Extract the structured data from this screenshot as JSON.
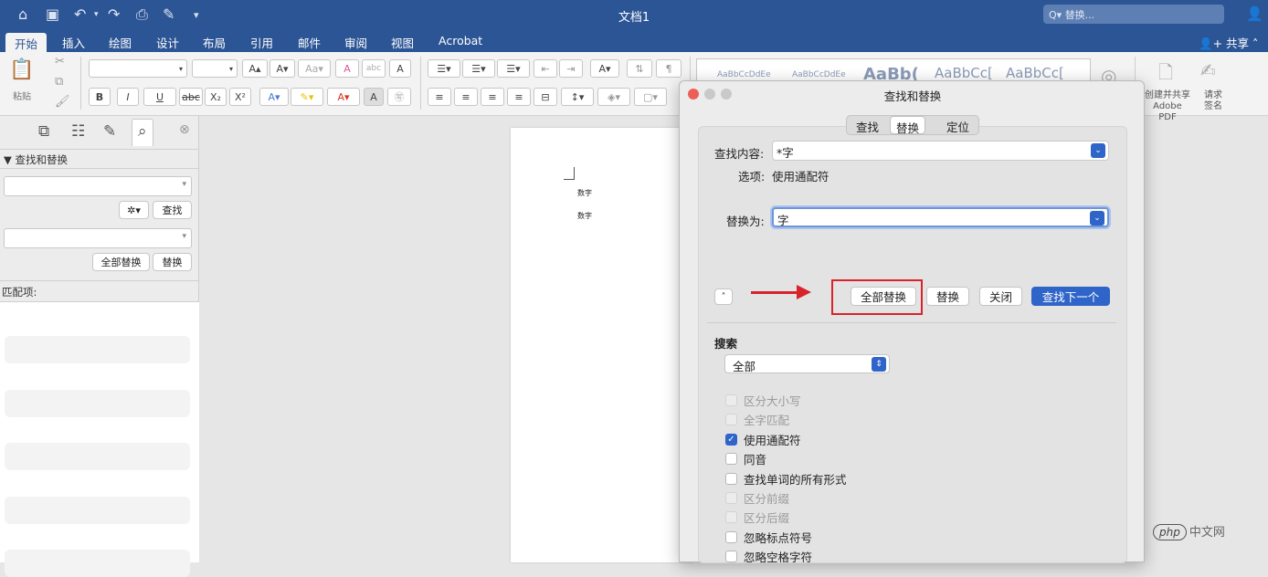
{
  "app": {
    "doc_title": "文档1",
    "search_placeholder": "替换...",
    "search_icon": "magnifier"
  },
  "menu": {
    "tabs": [
      "开始",
      "插入",
      "绘图",
      "设计",
      "布局",
      "引用",
      "邮件",
      "审阅",
      "视图",
      "Acrobat"
    ],
    "share": "共享"
  },
  "ribbon": {
    "paste": "粘贴",
    "bold": "B",
    "italic": "I",
    "underline": "U",
    "strike": "abc",
    "subscript": "X₂",
    "superscript": "X²",
    "font_grow": "A▴",
    "font_shrink": "A▾",
    "style_samples": [
      "AaBbCcDdEe",
      "AaBbCcDdEe",
      "AaBb(",
      "AaBbCc[",
      "AaBbCc["
    ],
    "create_share_pdf": "创建并共享 Adobe PDF",
    "request_sign": "请求 签名"
  },
  "sidebar": {
    "section_title": "查找和替换",
    "find_button": "查找",
    "replace_all_button": "全部替换",
    "replace_button": "替换",
    "matches_label": "匹配项:"
  },
  "document": {
    "lines": [
      "数字",
      "数字"
    ]
  },
  "dialog": {
    "title": "查找和替换",
    "tabs": [
      "查找",
      "替换",
      "定位"
    ],
    "selected_tab": "替换",
    "find_label": "查找内容:",
    "find_value": "*字",
    "options_label": "选项:",
    "options_value": "使用通配符",
    "replace_label": "替换为:",
    "replace_value": "字",
    "buttons": {
      "replace_all": "全部替换",
      "replace": "替换",
      "close": "关闭",
      "find_next": "查找下一个"
    },
    "search_section": "搜索",
    "search_scope": "全部",
    "checkboxes": [
      {
        "label": "区分大小写",
        "checked": false,
        "disabled": true
      },
      {
        "label": "全字匹配",
        "checked": false,
        "disabled": true
      },
      {
        "label": "使用通配符",
        "checked": true,
        "disabled": false
      },
      {
        "label": "同音",
        "checked": false,
        "disabled": false
      },
      {
        "label": "查找单词的所有形式",
        "checked": false,
        "disabled": false
      },
      {
        "label": "区分前缀",
        "checked": false,
        "disabled": true
      },
      {
        "label": "区分后缀",
        "checked": false,
        "disabled": true
      },
      {
        "label": "忽略标点符号",
        "checked": false,
        "disabled": false
      },
      {
        "label": "忽略空格字符",
        "checked": false,
        "disabled": false
      }
    ]
  },
  "watermark": {
    "logo": "php",
    "text": "中文网"
  },
  "colors": {
    "title_bar": "#2c5595",
    "accent": "#2f64c8",
    "highlight": "#d8232a"
  }
}
